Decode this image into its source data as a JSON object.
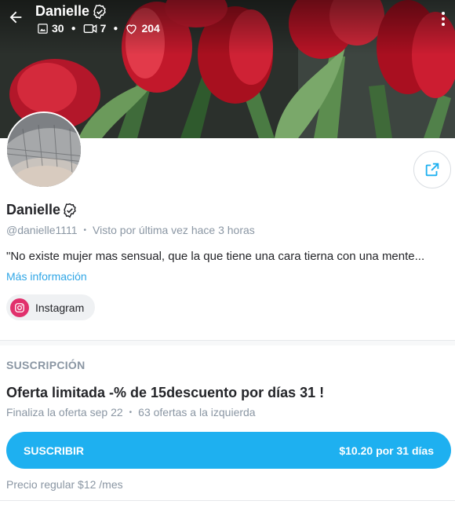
{
  "header": {
    "name": "Danielle",
    "stats": {
      "photos": "30",
      "videos": "7",
      "likes": "204"
    }
  },
  "profile": {
    "name": "Danielle",
    "handle": "@danielle1111",
    "last_seen": "Visto por última vez hace 3 horas",
    "bio": "\"No existe mujer mas sensual, que la que tiene una cara tierna con una mente...",
    "more_info": "Más información",
    "social": {
      "label": "Instagram"
    }
  },
  "subscription": {
    "section_title": "SUSCRIPCIÓN",
    "offer_title": "Oferta limitada -% de 15descuento por días 31 !",
    "offer_ends": "Finaliza la oferta sep 22",
    "offers_left": "63 ofertas a la izquierda",
    "button_label": "SUSCRIBIR",
    "button_price": "$10.20 por 31 días",
    "regular_price": "Precio regular $12 /mes"
  },
  "colors": {
    "accent": "#1eb0f0",
    "instagram": "#e1306c",
    "muted_text": "#8a96a3"
  }
}
